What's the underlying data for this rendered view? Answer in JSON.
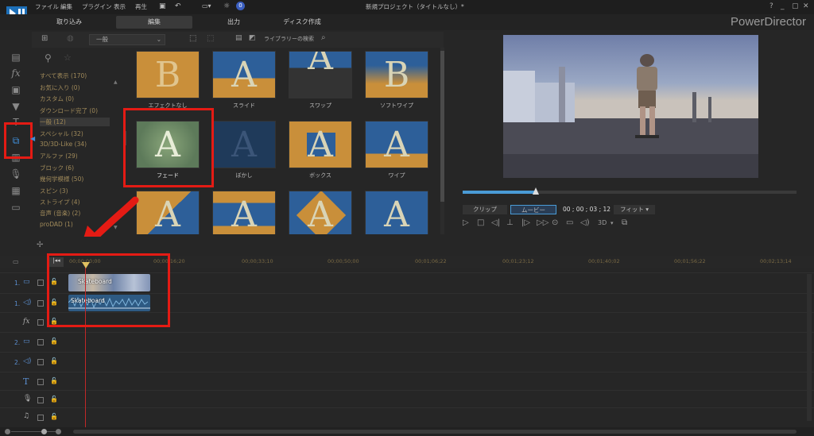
{
  "menu": [
    "ファイル",
    "編集",
    "プラグイン",
    "表示",
    "再生"
  ],
  "tabs": {
    "capture": "取り込み",
    "edit": "編集",
    "output": "出力",
    "disc": "ディスク作成"
  },
  "window_title": "新規プロジェクト（タイトルなし）*",
  "brand": "PowerDirector",
  "notification_count": "0",
  "window_controls": [
    "?",
    "_",
    "▢",
    "✕"
  ],
  "library": {
    "category_select": "一般",
    "search_label": "ライブラリーの検索"
  },
  "categories": [
    "すべて表示 (170)",
    "お気に入り (0)",
    "カスタム (0)",
    "ダウンロード完了 (0)",
    "一般 (12)",
    "スペシャル (32)",
    "3D/3D-Like (34)",
    "アルファ (29)",
    "ブロック (6)",
    "幾何学模様 (50)",
    "スピン (3)",
    "ストライプ (4)",
    "音声 (音楽) (2)",
    "proDAD (1)"
  ],
  "transitions": [
    {
      "label": "エフェクトなし",
      "letter": "B"
    },
    {
      "label": "スライド",
      "letter": "A"
    },
    {
      "label": "スワップ",
      "letter": "A"
    },
    {
      "label": "ソフトワイプ",
      "letter": "B"
    },
    {
      "label": "フェード",
      "letter": "A"
    },
    {
      "label": "ぼかし",
      "letter": "A"
    },
    {
      "label": "ボックス",
      "letter": "A"
    },
    {
      "label": "ワイプ",
      "letter": "A"
    },
    {
      "label": "",
      "letter": "A"
    },
    {
      "label": "",
      "letter": "A"
    },
    {
      "label": "",
      "letter": "A"
    },
    {
      "label": "",
      "letter": "A"
    }
  ],
  "preview": {
    "clip_tab": "クリップ",
    "movie_tab": "ムービー",
    "timecode": "00 ; 00 ; 03 ; 12",
    "fit": "フィット",
    "d3": "3D",
    "playback_progress": 0.22
  },
  "timeline": {
    "ticks": [
      "00;00;00;00",
      "00;00;16;20",
      "00;00;33;10",
      "00;00;50;00",
      "00;01;06;22",
      "00;01;23;12",
      "00;01;40;02",
      "00;01;56;22",
      "00;02;13;14"
    ],
    "tracks": [
      {
        "num": "1.",
        "icon": "video-track-icon"
      },
      {
        "num": "1.",
        "icon": "audio-track-icon"
      },
      {
        "num": "",
        "icon": "fx-track-icon",
        "symbol": "fx"
      },
      {
        "num": "2.",
        "icon": "video-track-icon"
      },
      {
        "num": "2.",
        "icon": "audio-track-icon"
      },
      {
        "num": "",
        "icon": "title-track-icon",
        "symbol": "T"
      },
      {
        "num": "",
        "icon": "voice-track-icon"
      },
      {
        "num": "",
        "icon": "music-track-icon"
      }
    ],
    "video_clip": "Skateboard",
    "audio_clip": "Skateboard"
  },
  "colors": {
    "highlight": "#e41b14",
    "accent": "#4a9bd6"
  }
}
